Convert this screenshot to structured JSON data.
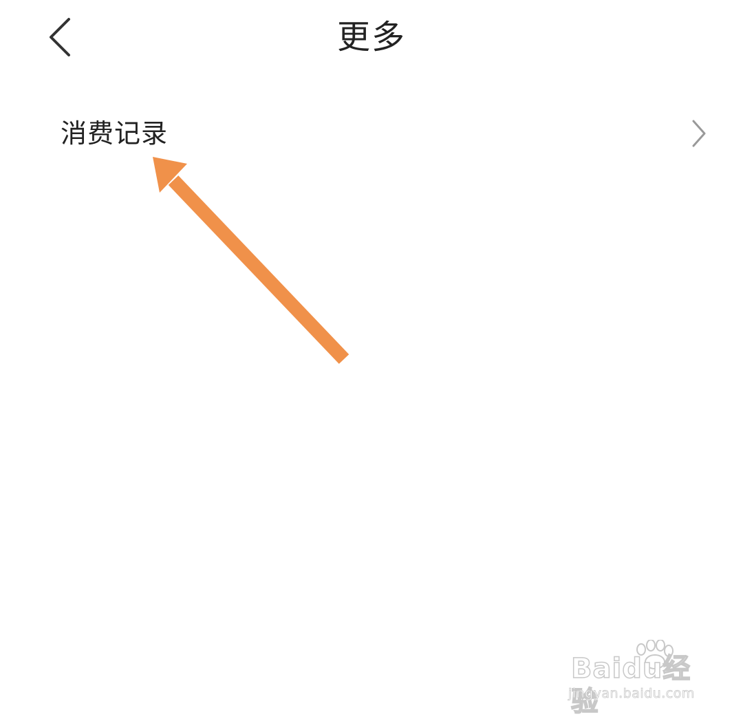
{
  "header": {
    "title": "更多",
    "back_icon": "chevron-left-icon"
  },
  "list": {
    "items": [
      {
        "label": "消费记录",
        "icon": "chevron-right-icon"
      }
    ]
  },
  "annotation": {
    "type": "arrow",
    "color": "#F0914A"
  },
  "watermark": {
    "brand": "Baidu经验",
    "url": "jingyan.baidu.com"
  },
  "colors": {
    "background": "#FFFFFF",
    "text": "#222222",
    "chevron": "#999999",
    "arrow": "#F0914A"
  }
}
